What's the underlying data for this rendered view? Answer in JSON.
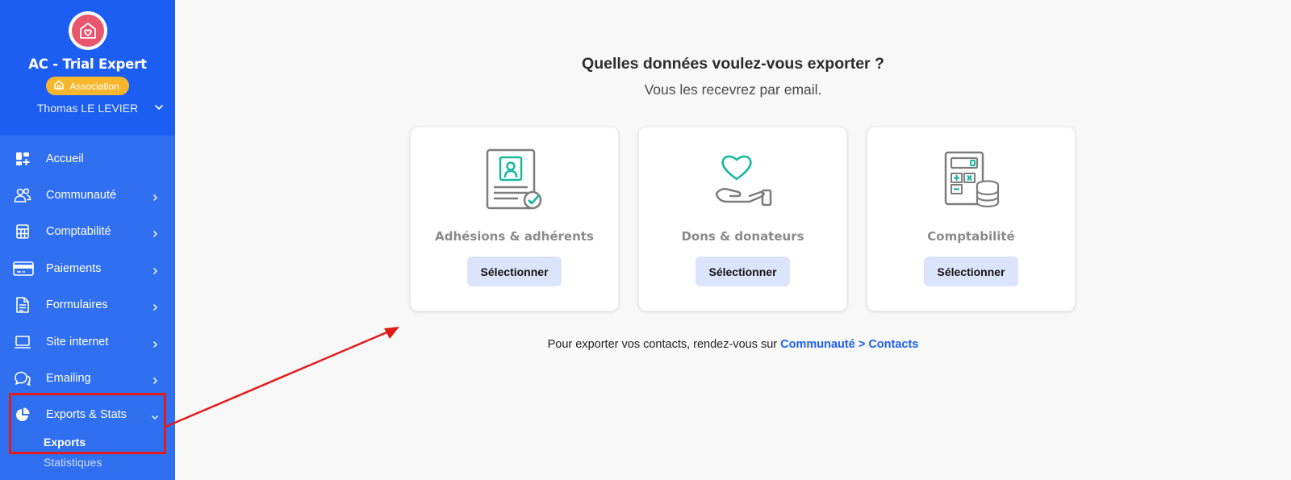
{
  "sidebar": {
    "org_name": "AC - Trial Expert",
    "org_badge": "Association",
    "user_name": "Thomas LE LEVIER",
    "items": [
      {
        "label": "Accueil",
        "icon": "dashboard-icon"
      },
      {
        "label": "Communauté",
        "icon": "users-icon"
      },
      {
        "label": "Comptabilité",
        "icon": "calculator-icon"
      },
      {
        "label": "Paiements",
        "icon": "credit-card-icon"
      },
      {
        "label": "Formulaires",
        "icon": "document-icon"
      },
      {
        "label": "Site internet",
        "icon": "laptop-icon"
      },
      {
        "label": "Emailing",
        "icon": "chat-icon"
      },
      {
        "label": "Exports & Stats",
        "icon": "pie-chart-icon"
      }
    ],
    "sub_items": [
      {
        "label": "Exports",
        "active": true
      },
      {
        "label": "Statistiques",
        "active": false
      }
    ]
  },
  "main": {
    "heading": "Quelles données voulez-vous exporter ?",
    "subheading": "Vous les recevrez par email.",
    "cards": [
      {
        "title": "Adhésions & adhérents",
        "button": "Sélectionner",
        "icon": "membership-certificate-icon"
      },
      {
        "title": "Dons & donateurs",
        "button": "Sélectionner",
        "icon": "donation-hand-icon"
      },
      {
        "title": "Comptabilité",
        "button": "Sélectionner",
        "icon": "accounting-calculator-icon"
      }
    ],
    "footer_text": "Pour exporter vos contacts, rendez-vous sur ",
    "footer_link": "Communauté > Contacts"
  },
  "colors": {
    "sidebar_bg": "#2f6ff0",
    "sidebar_header_bg": "#1d5ef2",
    "badge": "#f8b62c",
    "accent_link": "#1d5ef2",
    "annotation_red": "#e31b1b",
    "teal_icon": "#1bb8a0"
  }
}
